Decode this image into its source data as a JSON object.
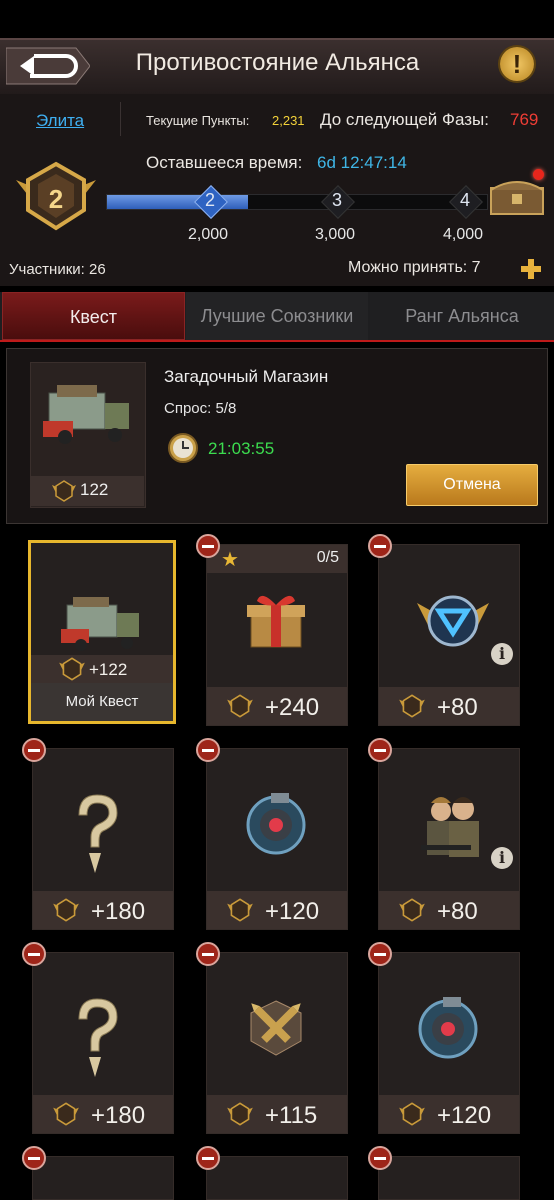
{
  "header": {
    "title": "Противостояние Альянса",
    "info": "!"
  },
  "stats": {
    "elite_label": "Элита",
    "points_label": "Текущие Пункты:",
    "points_value": "2,231",
    "next_phase_label": "До следующей Фазы:",
    "next_phase_value": "769",
    "time_label": "Оставшееся время:",
    "time_value": "6d 12:47:14",
    "rank": "2",
    "progress_fraction": 0.37,
    "milestones": [
      {
        "num": "2",
        "threshold": "2,000"
      },
      {
        "num": "3",
        "threshold": "3,000"
      },
      {
        "num": "4",
        "threshold": "4,000"
      }
    ],
    "participants": "Участники: 26",
    "can_accept": "Можно принять: 7"
  },
  "tabs": [
    {
      "label": "Квест"
    },
    {
      "label": "Лучшие Союзники"
    },
    {
      "label": "Ранг Альянса"
    }
  ],
  "shop": {
    "name": "Загадочный Магазин",
    "demand": "Спрос: 5/8",
    "timer": "21:03:55",
    "value": "122",
    "cancel": "Отмена"
  },
  "cards": [
    {
      "value": "+122",
      "footer": "Мой Квест",
      "icon": "truck-icon"
    },
    {
      "value": "+240",
      "counter": "0/5",
      "icon": "gift-box-icon"
    },
    {
      "value": "+80",
      "icon": "shield-badge-icon"
    },
    {
      "value": "+180",
      "icon": "question-icon"
    },
    {
      "value": "+120",
      "icon": "orb-device-icon"
    },
    {
      "value": "+80",
      "icon": "soldiers-icon"
    },
    {
      "value": "+180",
      "icon": "question-icon"
    },
    {
      "value": "+115",
      "icon": "crossed-bullets-icon"
    },
    {
      "value": "+120",
      "icon": "orb-device-icon"
    }
  ],
  "colors": {
    "accent": "#e5ad3f",
    "tab_active": "#7a1b1b",
    "progress": "#2f5fb9",
    "green": "#3cdc4f"
  }
}
